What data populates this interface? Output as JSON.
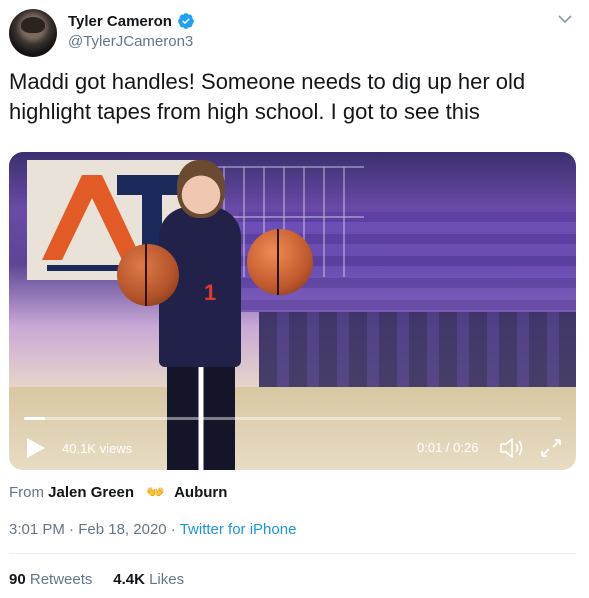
{
  "tweet": {
    "author_name": "Tyler Cameron",
    "handle": "@TylerJCameron3",
    "text": "Maddi got handles! Someone needs to dig up her old highlight tapes from high school. I got to see this"
  },
  "video": {
    "views": "40.1K views",
    "time": "0:01 / 0:26",
    "progress": 0.04
  },
  "attribution": {
    "from_label": "From",
    "user": "Jalen Green",
    "emoji": "👐",
    "school": "Auburn"
  },
  "meta": {
    "time": "3:01 PM",
    "sep1": "·",
    "date": "Feb 18, 2020",
    "sep2": "·",
    "client": "Twitter for iPhone"
  },
  "stats": {
    "retweets": "90",
    "retweets_label": "Retweets",
    "likes": "4.4K",
    "likes_label": "Likes"
  },
  "colors": {
    "link": "#1b95e0",
    "muted": "#657786",
    "verified": "#1da1f2"
  }
}
